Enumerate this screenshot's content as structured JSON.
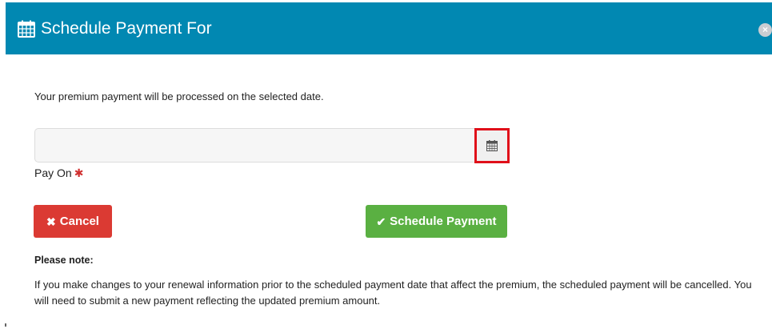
{
  "modal": {
    "title": "Schedule Payment For",
    "header_color": "#0188b2",
    "close_icon": "close-icon"
  },
  "intro_text": "Your premium payment will be processed on the selected date.",
  "date_field": {
    "value": "",
    "placeholder": "",
    "label": "Pay On",
    "required_marker": "✱",
    "calendar_icon": "calendar-icon"
  },
  "buttons": {
    "cancel_label": "Cancel",
    "cancel_icon": "✖",
    "cancel_color": "#db3a33",
    "schedule_label": "Schedule Payment",
    "schedule_icon": "✔",
    "schedule_color": "#5ab042"
  },
  "note": {
    "heading": "Please note:",
    "body": "If you make changes to your renewal information prior to the scheduled payment date that affect the premium, the scheduled payment will be cancelled. You will need to submit a new payment reflecting the updated premium amount."
  }
}
